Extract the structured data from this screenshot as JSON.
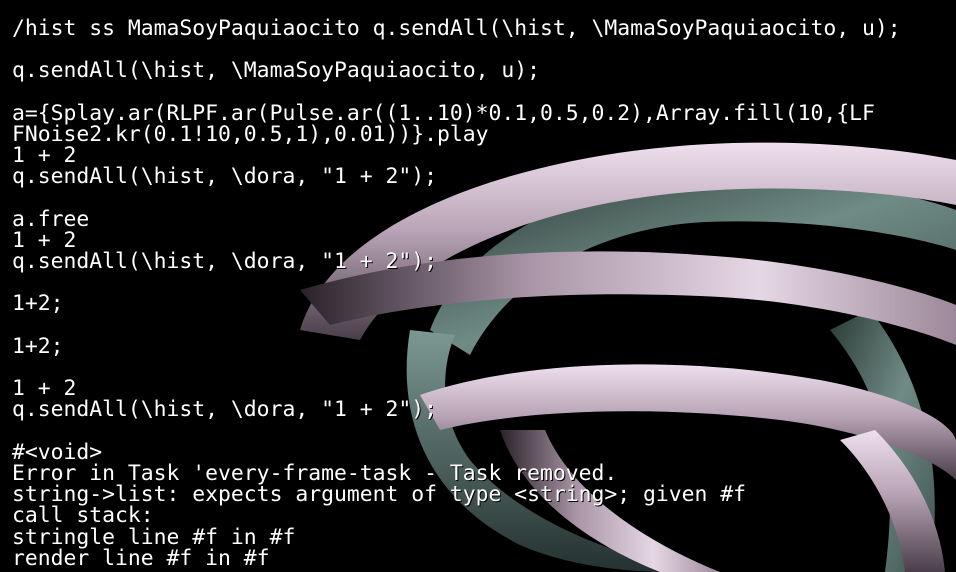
{
  "console": {
    "lines": [
      "/hist ss MamaSoyPaquiaocito q.sendAll(\\hist, \\MamaSoyPaquiaocito, u);",
      "",
      "q.sendAll(\\hist, \\MamaSoyPaquiaocito, u);",
      "",
      "a={Splay.ar(RLPF.ar(Pulse.ar((1..10)*0.1,0.5,0.2),Array.fill(10,{LF",
      "FNoise2.kr(0.1!10,0.5,1),0.01))}.play",
      "1 + 2",
      "q.sendAll(\\hist, \\dora, \"1 + 2\");",
      "",
      "a.free",
      "1 + 2",
      "q.sendAll(\\hist, \\dora, \"1 + 2\");",
      "",
      "1+2;",
      "",
      "1+2;",
      "",
      "1 + 2",
      "q.sendAll(\\hist, \\dora, \"1 + 2\");",
      "",
      "#<void>",
      "Error in Task 'every-frame-task - Task removed.",
      "string->list: expects argument of type <string>; given #f",
      "call stack:",
      "stringle line #f in #f",
      "render line #f in #f"
    ]
  },
  "scene": {
    "pink_ribbon_color": "#b8a4b6",
    "green_ribbon_color": "#5c7670",
    "background_color": "#000000"
  }
}
